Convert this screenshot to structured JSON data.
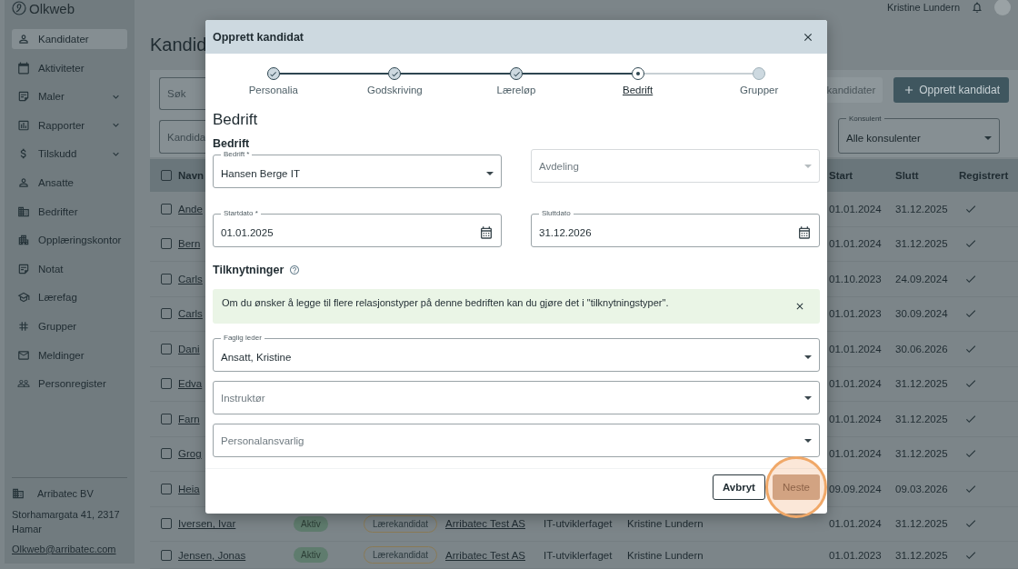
{
  "sidebar": {
    "logo": "Olkweb",
    "items": [
      {
        "label": "Kandidater",
        "selected": true,
        "expandable": false
      },
      {
        "label": "Aktiviteter",
        "selected": false,
        "expandable": false
      },
      {
        "label": "Maler",
        "selected": false,
        "expandable": true
      },
      {
        "label": "Rapporter",
        "selected": false,
        "expandable": true
      },
      {
        "label": "Tilskudd",
        "selected": false,
        "expandable": true
      },
      {
        "label": "Ansatte",
        "selected": false,
        "expandable": false
      },
      {
        "label": "Bedrifter",
        "selected": false,
        "expandable": false
      },
      {
        "label": "Opplæringskontor",
        "selected": false,
        "expandable": false
      },
      {
        "label": "Notat",
        "selected": false,
        "expandable": false
      },
      {
        "label": "Lærefag",
        "selected": false,
        "expandable": false
      },
      {
        "label": "Grupper",
        "selected": false,
        "expandable": false
      },
      {
        "label": "Meldinger",
        "selected": false,
        "expandable": false
      },
      {
        "label": "Personregister",
        "selected": false,
        "expandable": false
      }
    ],
    "organization": {
      "name": "Arribatec BV",
      "address": "Storhamargata 41, 2317 Hamar",
      "email": "Olkweb@arribatec.com"
    }
  },
  "header": {
    "user": "Kristine Lundern"
  },
  "page": {
    "title": "Kandid",
    "search_placeholder": "Søk",
    "filter_placeholder": "Kandida",
    "export_button": "kandidater",
    "create_button": "Opprett kandidat",
    "consultant_filter": {
      "label": "Konsulent",
      "value": "Alle konsulenter"
    }
  },
  "table": {
    "all_checked": false,
    "columns": {
      "name": "Navn",
      "start": "Start",
      "end": "Slutt",
      "registered": "Registrert"
    },
    "rows": [
      {
        "checked": false,
        "name": "Ande",
        "start": "01.01.2024",
        "end": "31.12.2025",
        "registered": true
      },
      {
        "checked": false,
        "name": "Bern",
        "start": "01.01.2024",
        "end": "31.12.2025",
        "registered": true
      },
      {
        "checked": false,
        "name": "Carls",
        "start": "01.10.2023",
        "end": "24.09.2024",
        "registered": true
      },
      {
        "checked": false,
        "name": "Carls",
        "start": "01.01.2023",
        "end": "30.09.2024",
        "registered": true
      },
      {
        "checked": false,
        "name": "Dani",
        "start": "01.01.2024",
        "end": "30.06.2026",
        "registered": true
      },
      {
        "checked": false,
        "name": "Edva",
        "start": "01.01.2024",
        "end": "31.12.2025",
        "registered": true
      },
      {
        "checked": false,
        "name": "Farn",
        "start": "01.01.2024",
        "end": "31.12.2025",
        "registered": true
      },
      {
        "checked": false,
        "name": "Grog",
        "start": "01.01.2024",
        "end": "31.12.2025",
        "registered": true
      },
      {
        "checked": false,
        "name": "Heia",
        "start": "09.09.2024",
        "end": "09.03.2026",
        "registered": true
      },
      {
        "checked": false,
        "name": "Iversen, Ivar",
        "status": "Aktiv",
        "type": "Lærekandidat",
        "company": "Arribatec Test AS",
        "subject": "IT-utviklerfaget",
        "consultant": "Kristine Lundern",
        "start": "01.01.2024",
        "end": "31.12.2025",
        "registered": true
      },
      {
        "checked": false,
        "name": "Jensen, Jonas",
        "status": "Aktiv",
        "type": "Lærekandidat",
        "company": "Arribatec Test AS",
        "subject": "IT-utviklerfaget",
        "consultant": "Kristine Lundern",
        "start": "01.01.2023",
        "end": "31.12.2025",
        "registered": true
      }
    ]
  },
  "dialog": {
    "title": "Opprett kandidat",
    "steps": [
      {
        "label": "Personalia",
        "done": true,
        "selected": false
      },
      {
        "label": "Godskriving",
        "done": true,
        "selected": false
      },
      {
        "label": "Læreløp",
        "done": true,
        "selected": false
      },
      {
        "label": "Bedrift",
        "done": false,
        "selected": true
      },
      {
        "label": "Grupper",
        "done": false,
        "selected": false
      }
    ],
    "heading": "Bedrift",
    "subheading": "Bedrift",
    "company_fields": [
      {
        "label": "Bedrift *",
        "value": "Hansen Berge IT",
        "kind": "select"
      },
      {
        "placeholder": "Avdeling",
        "kind": "select"
      }
    ],
    "date_fields": [
      {
        "label": "Startdato *",
        "value": "01.01.2025",
        "kind": "date"
      },
      {
        "label": "Sluttdato",
        "value": "31.12.2026",
        "kind": "date"
      }
    ],
    "relations_heading": "Tilknytninger",
    "info": "Om du ønsker å legge til flere relasjonstyper på denne bedriften kan du gjøre det i \"tilknytningstyper\".",
    "relation_fields": [
      {
        "label": "Faglig leder",
        "value": "Ansatt, Kristine",
        "kind": "select"
      },
      {
        "placeholder": "Instruktør",
        "kind": "select"
      },
      {
        "placeholder": "Personalansvarlig",
        "kind": "select"
      }
    ],
    "buttons": {
      "cancel": "Avbryt",
      "next": "Neste"
    },
    "highlight_next": true
  }
}
